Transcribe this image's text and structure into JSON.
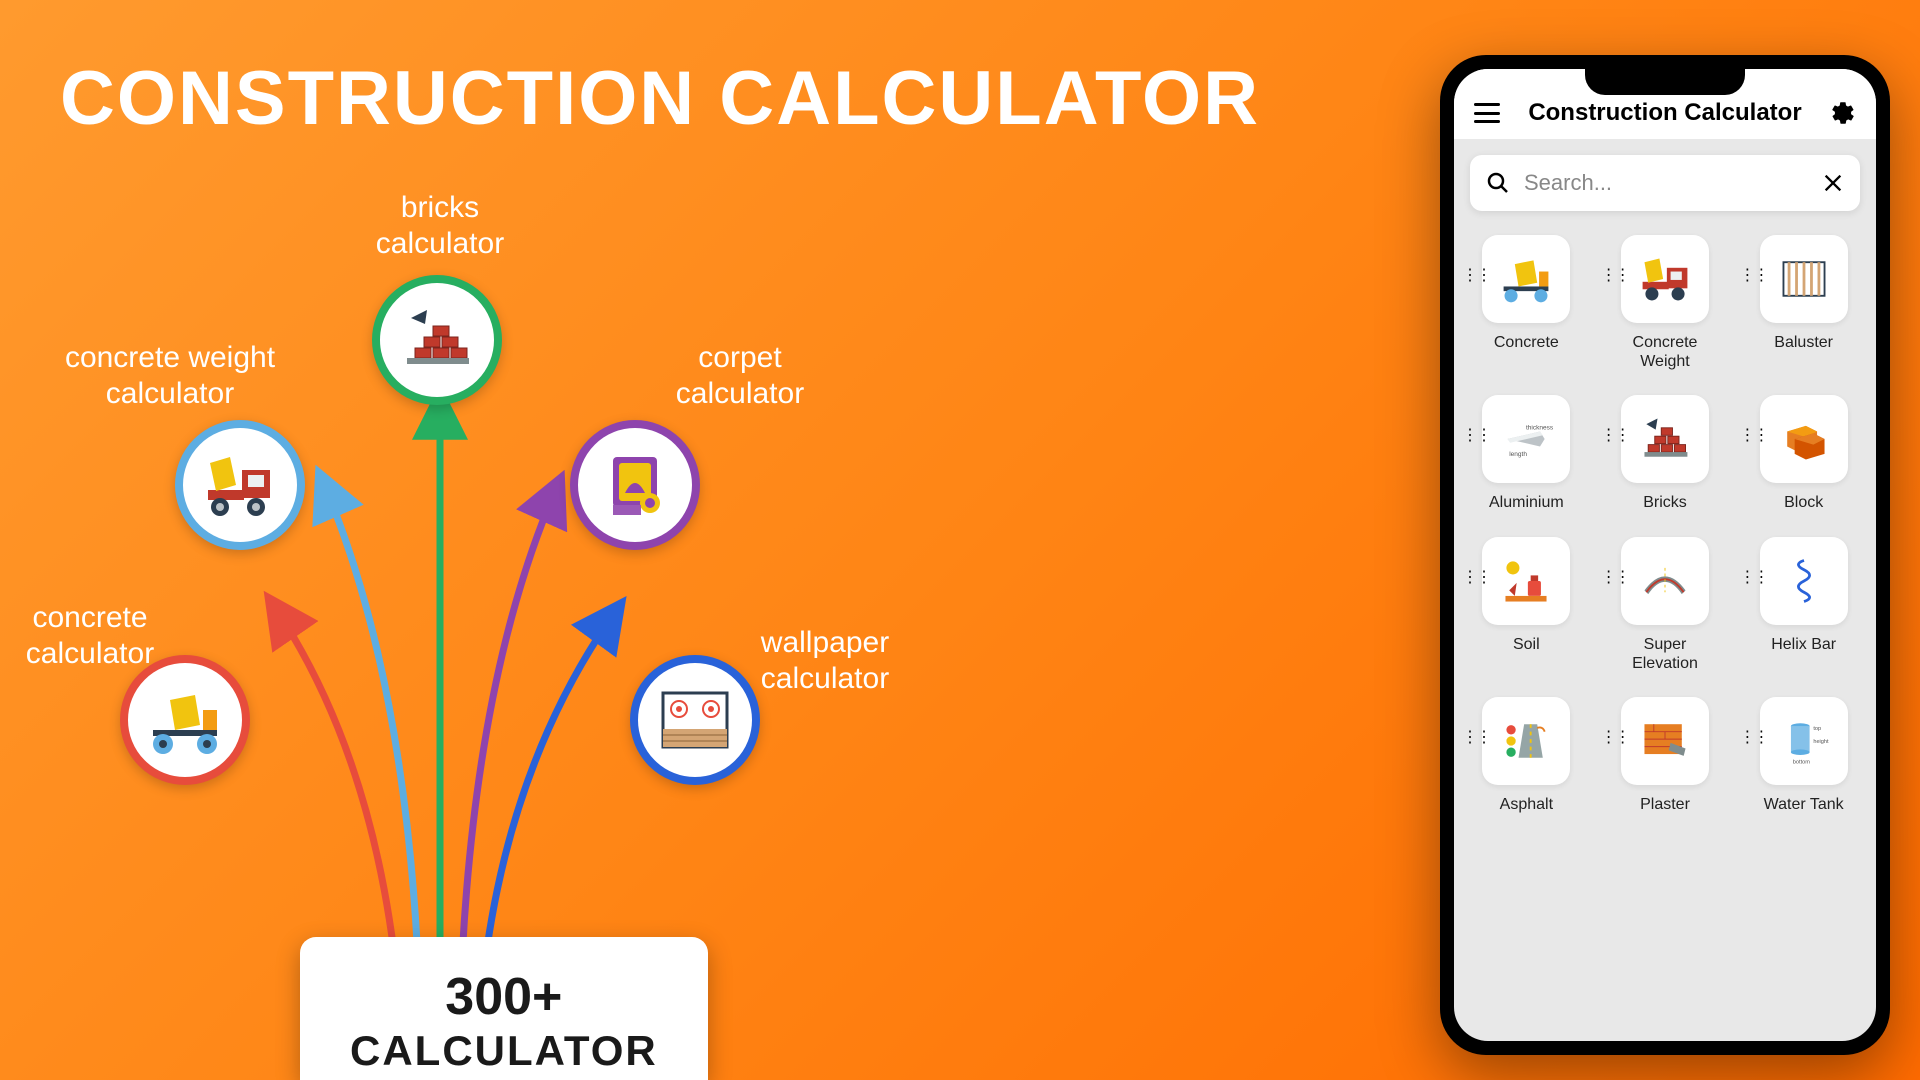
{
  "title": "CONSTRUCTION CALCULATOR",
  "counter": {
    "num": "300+",
    "label": "CALCULATOR"
  },
  "bubbles": {
    "concrete": {
      "label1": "concrete",
      "label2": "calculator"
    },
    "concrete_weight": {
      "label1": "concrete weight",
      "label2": "calculator"
    },
    "bricks": {
      "label1": "bricks",
      "label2": "calculator"
    },
    "corpet": {
      "label1": "corpet",
      "label2": "calculator"
    },
    "wallpaper": {
      "label1": "wallpaper",
      "label2": "calculator"
    }
  },
  "app": {
    "title": "Construction Calculator",
    "search_placeholder": "Search...",
    "items": [
      {
        "label": "Concrete"
      },
      {
        "label": "Concrete Weight"
      },
      {
        "label": "Baluster"
      },
      {
        "label": "Aluminium"
      },
      {
        "label": "Bricks"
      },
      {
        "label": "Block"
      },
      {
        "label": "Soil"
      },
      {
        "label": "Super Elevation"
      },
      {
        "label": "Helix Bar"
      },
      {
        "label": "Asphalt"
      },
      {
        "label": "Plaster"
      },
      {
        "label": "Water Tank"
      }
    ]
  },
  "colors": {
    "red": "#e74c3c",
    "blue_light": "#5dade2",
    "green": "#27ae60",
    "purple": "#8e44ad",
    "blue": "#2962d9"
  }
}
